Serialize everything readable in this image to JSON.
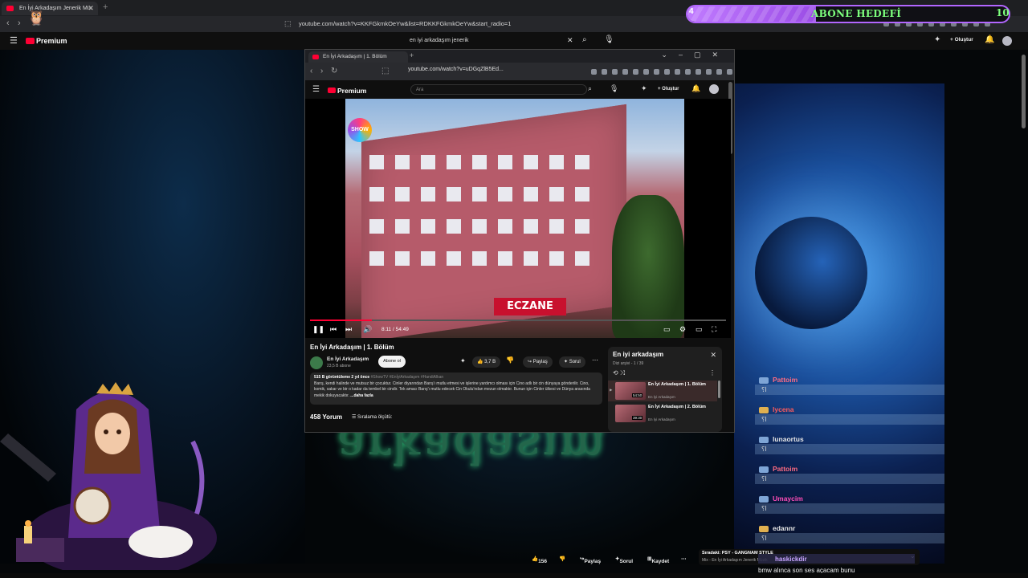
{
  "outer_browser": {
    "tab_title": "En İyi Arkadaşım Jenerik Mü:",
    "url": "youtube.com/watch?v=KKFGkmkOeYw&list=RDKKFGkmkOeYw&start_radio=1",
    "new_tab_symbol": "+"
  },
  "goal": {
    "current": "4",
    "target": "10",
    "title": "ABONE HEDEFİ",
    "fill_fraction": 0.4,
    "color": "#b266ff"
  },
  "outer_youtube": {
    "logo": "Premium",
    "search_query": "en iyi arkadaşım jenerik",
    "create_label": "Oluştur"
  },
  "inner_browser": {
    "tab_title": "En İyi Arkadaşım | 1. Bölüm",
    "url": "youtube.com/watch?v=uDGqZlB5Ed...",
    "search_placeholder": "Ara",
    "logo": "Premium",
    "create_label": "Oluştur"
  },
  "video": {
    "overlay_logo": "SHOW",
    "sign_text": "ECZANE",
    "time": "8:11 / 54:49",
    "progress_fraction": 0.149,
    "title": "En İyi Arkadaşım | 1. Bölüm",
    "channel": "En İyi Arkadaşım",
    "subscribers": "23,5 B abone",
    "subscribe_label": "Abone ol",
    "likes": "3,7 B",
    "share_label": "Paylaş",
    "save_label": "Sorul",
    "description_meta": "515 B görüntüleme  2 yıl önce",
    "description_tags": "#ShowTV #EnİyiArkadaşım #HandiAlkan",
    "description_text": "Barış, kendi halinde ve mutsuz bir çocuktur. Cinler diyarından Barış'ı mutlu etmesi ve işlerine yardımcı olması için Cino adlı bir cin dünyaya gönderilir. Cino, komik, sakar ve bir o kadar da tembel bir cindir. Tek amacı Barış'ı mutlu edecek Cin Okulu'ndan mezun olmaktır. Bunun için Cinler ülkesi ve Dünya arasında mekik dokuyacaktır.",
    "more_label": "...daha fazla",
    "comment_count": "458 Yorum",
    "sort_label": "Sıralama ölçütü:"
  },
  "playlist": {
    "title": "En iyi arkadaşım",
    "subtitle": "Dizi arşivi - 1 / 39",
    "items": [
      {
        "title": "En İyi Arkadaşım | 1. Bölüm",
        "channel": "En İyi Arkadaşım",
        "duration": "54:50"
      },
      {
        "title": "En İyi Arkadaşım | 2. Bölüm",
        "channel": "En İyi Arkadaşım",
        "duration": "39:30"
      }
    ]
  },
  "bottom_bar": {
    "likes": "156",
    "share_label": "Paylaş",
    "save_label": "Sorul",
    "save2_label": "Kaydet"
  },
  "mini_player": {
    "title": "Sıradaki: PSY - GANGNAM STYLE",
    "subtitle": "Mix - En İyi Arkadaşım Jenerik Müzik"
  },
  "background_caption": "arkadaşım",
  "chat": [
    {
      "name": "Pattoim",
      "message": "ا؟",
      "color": "#ff6b81"
    },
    {
      "name": "lycena",
      "message": "ا؟",
      "color": "#ff5b5b"
    },
    {
      "name": "lunaortus",
      "message": "ا؟",
      "color": "#e6e6e6"
    },
    {
      "name": "Pattoim",
      "message": "ا؟",
      "color": "#ff6b81"
    },
    {
      "name": "Umaycim",
      "message": "ا؟",
      "color": "#ff4db8"
    },
    {
      "name": "edannr",
      "message": "ا؟",
      "color": "#e6e6e6"
    }
  ],
  "last_chat": {
    "name": "haskickdir",
    "message": "bmw alınca son ses açacam bunu"
  }
}
